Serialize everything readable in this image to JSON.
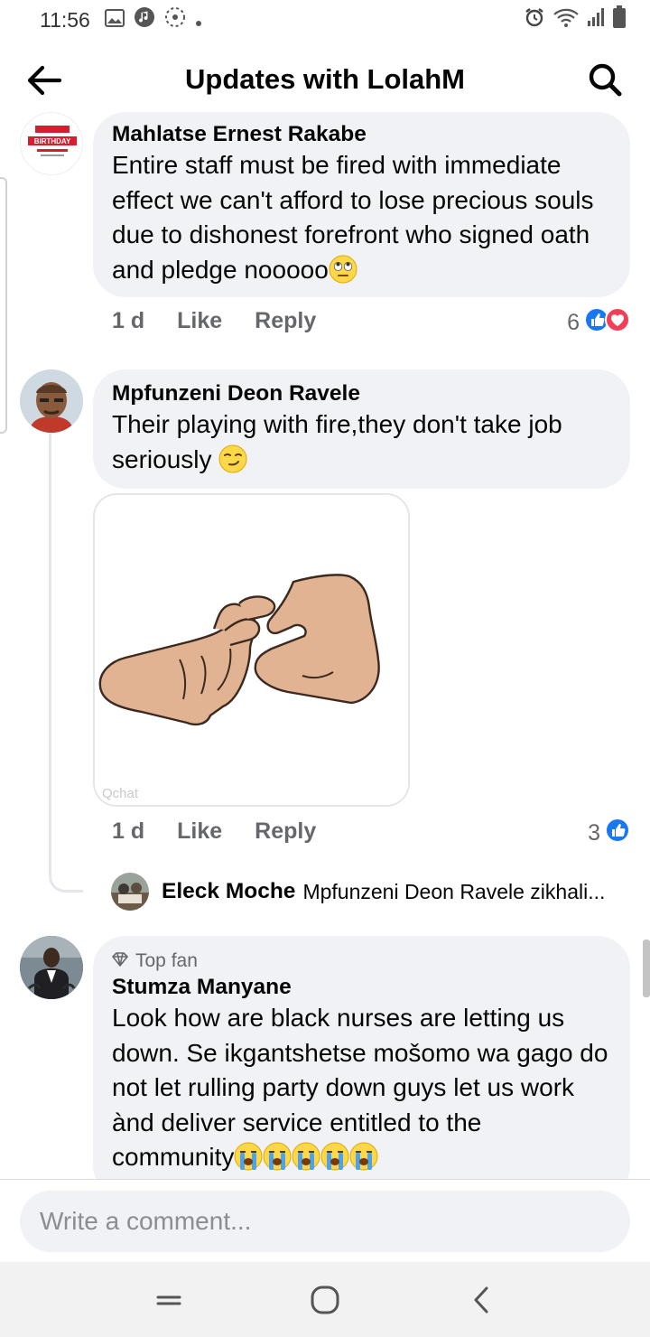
{
  "status_bar": {
    "time": "11:56"
  },
  "header": {
    "title": "Updates with LolahM"
  },
  "comments": [
    {
      "name": "Mahlatse Ernest Rakabe",
      "text": "Entire staff must be fired with immediate effect we can't afford to lose precious souls due to dishonest forefront who signed oath and pledge nooooo",
      "age": "1 d",
      "like_label": "Like",
      "reply_label": "Reply",
      "reaction_count": "6",
      "avatar_text": "BIRTHDAY"
    },
    {
      "name": "Mpfunzeni Deon Ravele",
      "text": "Their playing with fire,they don't take job seriously",
      "age": "1 d",
      "like_label": "Like",
      "reply_label": "Reply",
      "reaction_count": "3",
      "sticker_watermark": "Qchat",
      "reply_preview": {
        "name": "Eleck Moche",
        "text": "Mpfunzeni Deon Ravele zikhali..."
      }
    },
    {
      "badge": "Top fan",
      "name": "Stumza Manyane",
      "text": "Look how are black nurses are letting us down. Se ikgantshetse mošomo wa gago do not let rulling party down guys let us work ànd deliver service entitled to the community"
    }
  ],
  "composer": {
    "placeholder": "Write a comment..."
  },
  "colors": {
    "like_blue": "#1877f2",
    "love_red": "#f33e58",
    "bubble": "#f0f2f5",
    "secondary_text": "#65676b"
  }
}
